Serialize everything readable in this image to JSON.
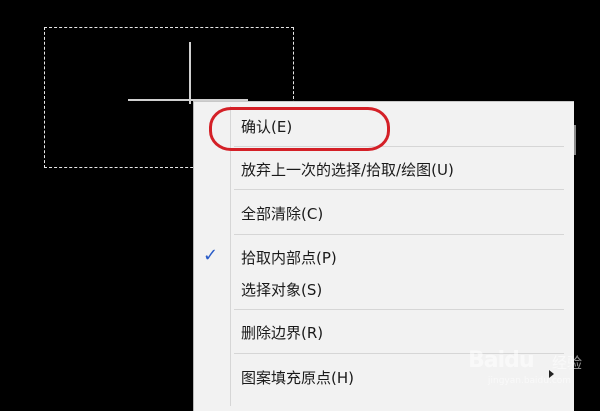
{
  "canvas": {
    "background": "#000000"
  },
  "context_menu": {
    "items": [
      {
        "label": "确认(E)",
        "checked": false,
        "has_submenu": false
      },
      {
        "label": "放弃上一次的选择/拾取/绘图(U)",
        "checked": false,
        "has_submenu": false
      },
      {
        "label": "全部清除(C)",
        "checked": false,
        "has_submenu": false
      },
      {
        "label": "拾取内部点(P)",
        "checked": true,
        "has_submenu": false
      },
      {
        "label": "选择对象(S)",
        "checked": false,
        "has_submenu": false
      },
      {
        "label": "删除边界(R)",
        "checked": false,
        "has_submenu": false
      },
      {
        "label": "图案填充原点(H)",
        "checked": false,
        "has_submenu": true
      }
    ],
    "check_glyph": "✓",
    "check_color": "#2a5cc8"
  },
  "annotation": {
    "highlight_color": "#d42027"
  },
  "watermark": {
    "brand": "Baidu",
    "sub": "经验",
    "url": "jingyan.baidu.com"
  }
}
